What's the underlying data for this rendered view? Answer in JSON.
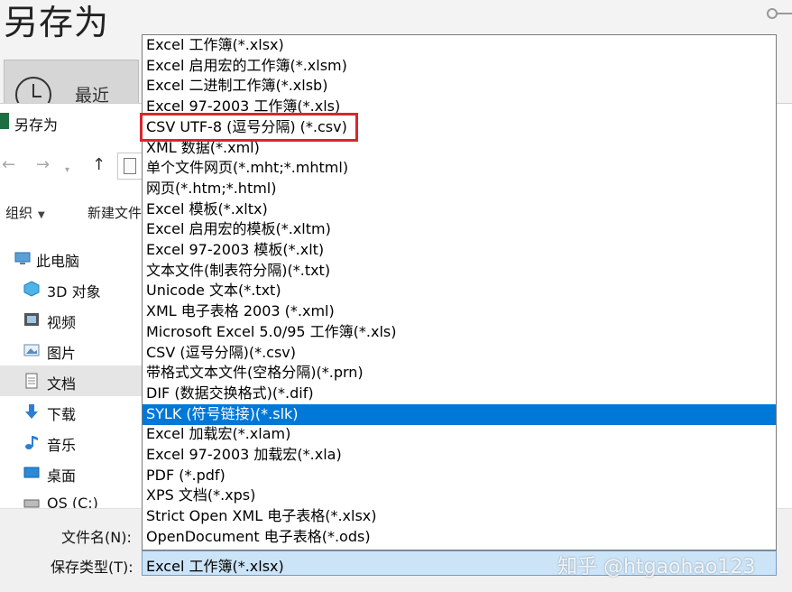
{
  "backstage": {
    "title": "另存为",
    "recent_label": "最近"
  },
  "dialog": {
    "title": "另存为",
    "toolbar": {
      "organize": "组织",
      "new_folder": "新建文件"
    },
    "sidebar": [
      {
        "label": "此电脑",
        "icon": "computer-icon"
      },
      {
        "label": "3D 对象",
        "icon": "cube-icon"
      },
      {
        "label": "视频",
        "icon": "video-icon"
      },
      {
        "label": "图片",
        "icon": "picture-icon"
      },
      {
        "label": "文档",
        "icon": "document-icon"
      },
      {
        "label": "下载",
        "icon": "download-arrow-icon"
      },
      {
        "label": "音乐",
        "icon": "music-note-icon"
      },
      {
        "label": "桌面",
        "icon": "desktop-icon"
      },
      {
        "label": "OS (C:)",
        "icon": "drive-icon"
      }
    ],
    "filename_label": "文件名(N):",
    "filetype_label": "保存类型(T):",
    "filetype_value": "Excel 工作簿(*.xlsx)"
  },
  "dropdown": {
    "options": [
      "Excel 工作簿(*.xlsx)",
      "Excel 启用宏的工作簿(*.xlsm)",
      "Excel 二进制工作簿(*.xlsb)",
      "Excel 97-2003 工作簿(*.xls)",
      "CSV UTF-8 (逗号分隔) (*.csv)",
      "XML 数据(*.xml)",
      "单个文件网页(*.mht;*.mhtml)",
      "网页(*.htm;*.html)",
      "Excel 模板(*.xltx)",
      "Excel 启用宏的模板(*.xltm)",
      "Excel 97-2003 模板(*.xlt)",
      "文本文件(制表符分隔)(*.txt)",
      "Unicode 文本(*.txt)",
      "XML 电子表格 2003 (*.xml)",
      "Microsoft Excel 5.0/95 工作簿(*.xls)",
      "CSV (逗号分隔)(*.csv)",
      "带格式文本文件(空格分隔)(*.prn)",
      "DIF (数据交换格式)(*.dif)",
      "SYLK (符号链接)(*.slk)",
      "Excel 加载宏(*.xlam)",
      "Excel 97-2003 加载宏(*.xla)",
      "PDF (*.pdf)",
      "XPS 文档(*.xps)",
      "Strict Open XML 电子表格(*.xlsx)",
      "OpenDocument 电子表格(*.ods)"
    ],
    "highlighted_index": 18,
    "boxed_index": 4
  },
  "watermark": "知乎 @htgaohao123",
  "colors": {
    "highlight": "#0078d7",
    "annotation_box": "#d9262c",
    "select_fill": "#cce4f7"
  }
}
